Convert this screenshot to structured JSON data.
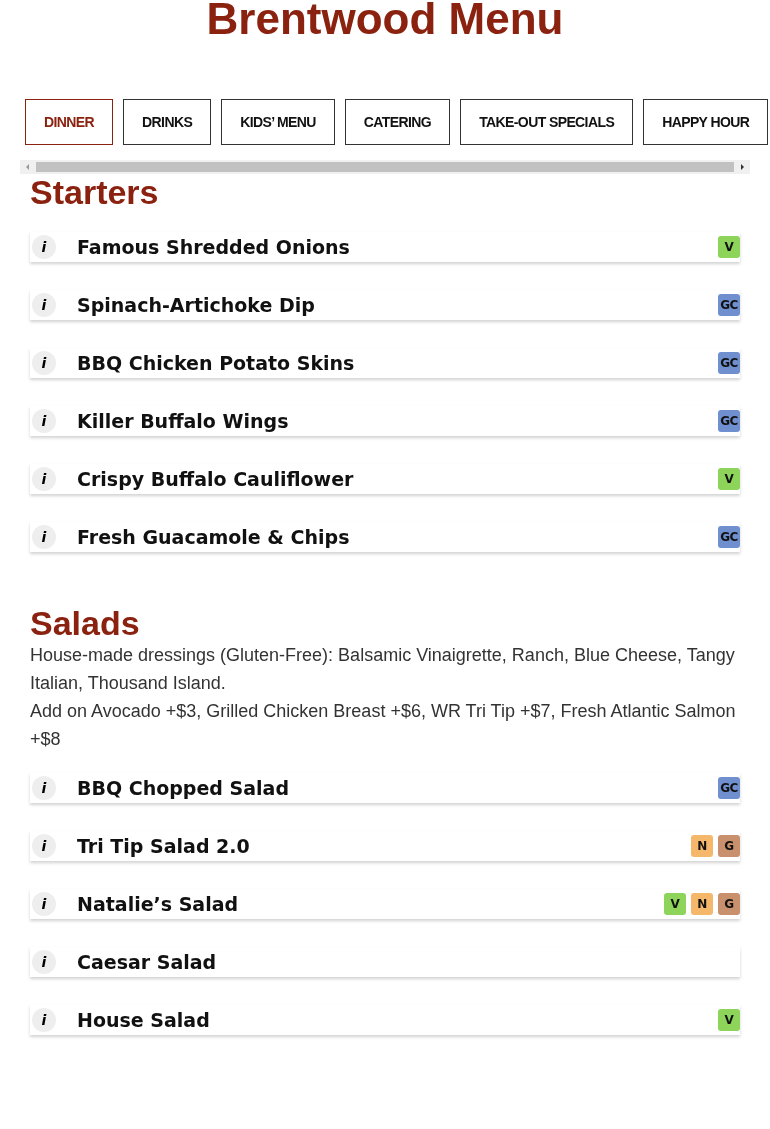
{
  "title": "Brentwood Menu",
  "tabs": [
    {
      "label": "DINNER",
      "selected": true
    },
    {
      "label": "DRINKS",
      "selected": false
    },
    {
      "label": "KIDS’ MENU",
      "selected": false
    },
    {
      "label": "CATERING",
      "selected": false
    },
    {
      "label": "TAKE-OUT SPECIALS",
      "selected": false
    },
    {
      "label": "HAPPY HOUR",
      "selected": false
    }
  ],
  "sections": [
    {
      "heading": "Starters",
      "items": [
        {
          "info": "i",
          "name": "Famous Shredded Onions",
          "badges": [
            {
              "label": "V",
              "color": "#8fd45a"
            }
          ]
        },
        {
          "info": "i",
          "name": "Spinach-Artichoke Dip",
          "badges": [
            {
              "label": "GC",
              "color": "#6f8fcf"
            }
          ]
        },
        {
          "info": "i",
          "name": "BBQ Chicken Potato Skins",
          "badges": [
            {
              "label": "GC",
              "color": "#6f8fcf"
            }
          ]
        },
        {
          "info": "i",
          "name": "Killer Buffalo Wings",
          "badges": [
            {
              "label": "GC",
              "color": "#6f8fcf"
            }
          ]
        },
        {
          "info": "i",
          "name": "Crispy Buffalo Cauliflower",
          "badges": [
            {
              "label": "V",
              "color": "#8fd45a"
            }
          ]
        },
        {
          "info": "i",
          "name": "Fresh Guacamole & Chips",
          "badges": [
            {
              "label": "GC",
              "color": "#6f8fcf"
            }
          ]
        }
      ]
    },
    {
      "heading": "Salads",
      "notes": [
        "House-made dressings (Gluten-Free): Balsamic Vinaigrette, Ranch, Blue Cheese, Tangy Italian, Thousand Island.",
        "Add on Avocado +$3, Grilled Chicken Breast +$6, WR Tri Tip +$7, Fresh Atlantic Salmon +$8"
      ],
      "items": [
        {
          "info": "i",
          "name": "BBQ Chopped Salad",
          "badges": [
            {
              "label": "GC",
              "color": "#6f8fcf"
            }
          ]
        },
        {
          "info": "i",
          "name": "Tri Tip Salad 2.0",
          "badges": [
            {
              "label": "N",
              "color": "#f5b76a"
            },
            {
              "label": "G",
              "color": "#c8906c"
            }
          ]
        },
        {
          "info": "i",
          "name": "Natalie’s Salad",
          "badges": [
            {
              "label": "V",
              "color": "#8fd45a"
            },
            {
              "label": "N",
              "color": "#f5b76a"
            },
            {
              "label": "G",
              "color": "#c8906c"
            }
          ]
        },
        {
          "info": "i",
          "name": "Caesar Salad"
        },
        {
          "info": "i",
          "name": "House Salad",
          "badges": [
            {
              "label": "V",
              "color": "#8fd45a"
            }
          ]
        }
      ]
    }
  ]
}
